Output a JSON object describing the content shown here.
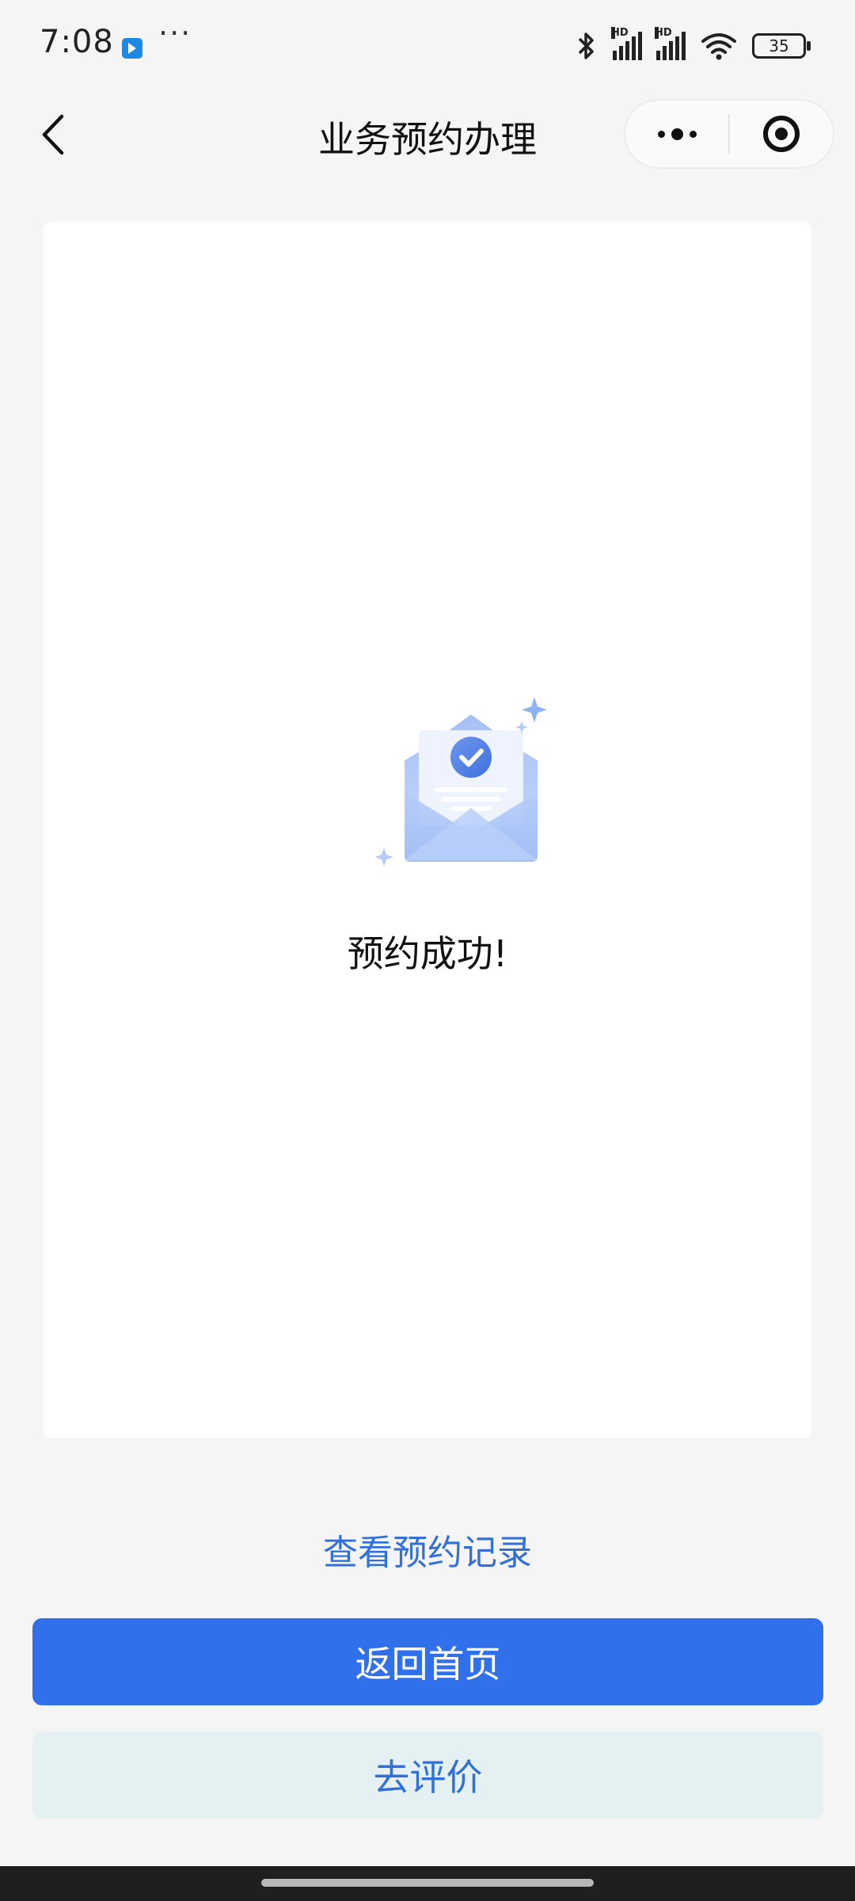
{
  "status_bar": {
    "time": "7:08",
    "more": "···",
    "battery": "35",
    "signal_label": "HD",
    "icons": [
      "notification-app-icon",
      "bluetooth-icon",
      "signal-icon",
      "signal-icon",
      "wifi-icon",
      "battery-icon"
    ]
  },
  "nav": {
    "title": "业务预约办理",
    "back_icon": "chevron-left-icon",
    "capsule_icons": [
      "more-dots-icon",
      "close-target-icon"
    ]
  },
  "result": {
    "illustration": "envelope-check-icon",
    "message": "预约成功!"
  },
  "actions": {
    "view_records": "查看预约记录",
    "return_home": "返回首页",
    "rate": "去评价"
  },
  "colors": {
    "accent": "#3170eb",
    "link": "#3170d8",
    "secondary_button_bg": "#e4f0f2",
    "page_bg": "#f5f5f5",
    "illustration_blue": "#8fb2f5"
  }
}
